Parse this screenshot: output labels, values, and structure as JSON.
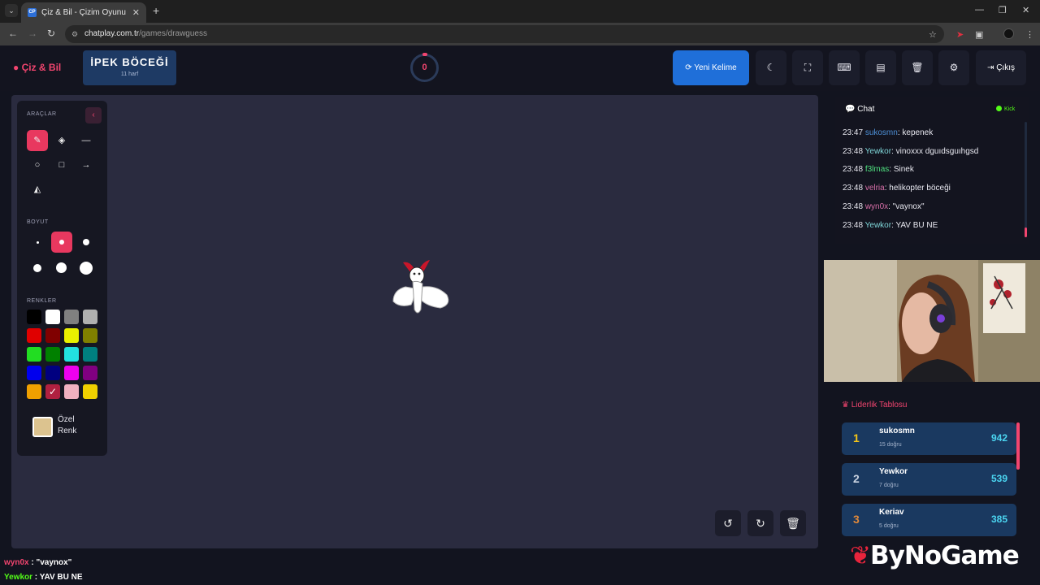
{
  "browser": {
    "tab_title": "Çiz & Bil - Çizim Oyunu",
    "tab_favicon": "CP",
    "url_host": "chatplay.com.tr",
    "url_path": "/games/drawguess"
  },
  "header": {
    "logo": "Çiz & Bil",
    "word": "İPEK BÖCEĞİ",
    "word_hint": "11 harf",
    "timer": "0",
    "new_word_label": "Yeni Kelime",
    "exit_label": "Çıkış",
    "icons": [
      "moon-icon",
      "fullscreen-icon",
      "keyboard-icon",
      "archive-icon",
      "trash-icon",
      "gear-icon"
    ]
  },
  "tools": {
    "section_tools": "ARAÇLAR",
    "section_size": "BOYUT",
    "section_colors": "RENKLER",
    "custom_color_label": "Özel Renk",
    "custom_color": "#dcc38f",
    "colors": [
      "#000000",
      "#ffffff",
      "#808080",
      "#b0b0b0",
      "#e00000",
      "#800000",
      "#e8f000",
      "#808000",
      "#22dd22",
      "#008000",
      "#22e0e0",
      "#008080",
      "#0000ee",
      "#000080",
      "#ee00ee",
      "#800080",
      "#f0a000",
      "#b02040",
      "#f0b0c0",
      "#f0d000"
    ]
  },
  "chat": {
    "title": "Chat",
    "platform": "Kick",
    "messages": [
      {
        "time": "23:47",
        "user": "sukosmn",
        "color": "#4d8fd6",
        "text": ": kepenek"
      },
      {
        "time": "23:48",
        "user": "Yewkor",
        "color": "#7fd6d8",
        "text": ": vinoxxx dguıdsguıhgsd"
      },
      {
        "time": "23:48",
        "user": "f3lmas",
        "color": "#4fe07f",
        "text": ": Sinek"
      },
      {
        "time": "23:48",
        "user": "velria",
        "color": "#d86fa8",
        "text": ": helikopter böceği"
      },
      {
        "time": "23:48",
        "user": "wyn0x",
        "color": "#d86fa8",
        "text": ": \"vaynox\""
      },
      {
        "time": "23:48",
        "user": "Yewkor",
        "color": "#7fd6d8",
        "text": ": YAV BU NE"
      }
    ]
  },
  "leaderboard": {
    "title": "Liderlik Tablosu",
    "rows": [
      {
        "rank": "1",
        "name": "sukosmn",
        "sub": "15 doğru",
        "score": "942",
        "rank_color": "#f5c518"
      },
      {
        "rank": "2",
        "name": "Yewkor",
        "sub": "7 doğru",
        "score": "539",
        "rank_color": "#c9d2e0"
      },
      {
        "rank": "3",
        "name": "Keriav",
        "sub": "5 doğru",
        "score": "385",
        "rank_color": "#e0893a"
      }
    ]
  },
  "overlay": {
    "msg1_user": "wyn0x",
    "msg1_text": " : \"vaynox\"",
    "msg2_user": "Yewkor",
    "msg2_text": " : YAV BU NE",
    "brand": "ByNoGame"
  }
}
